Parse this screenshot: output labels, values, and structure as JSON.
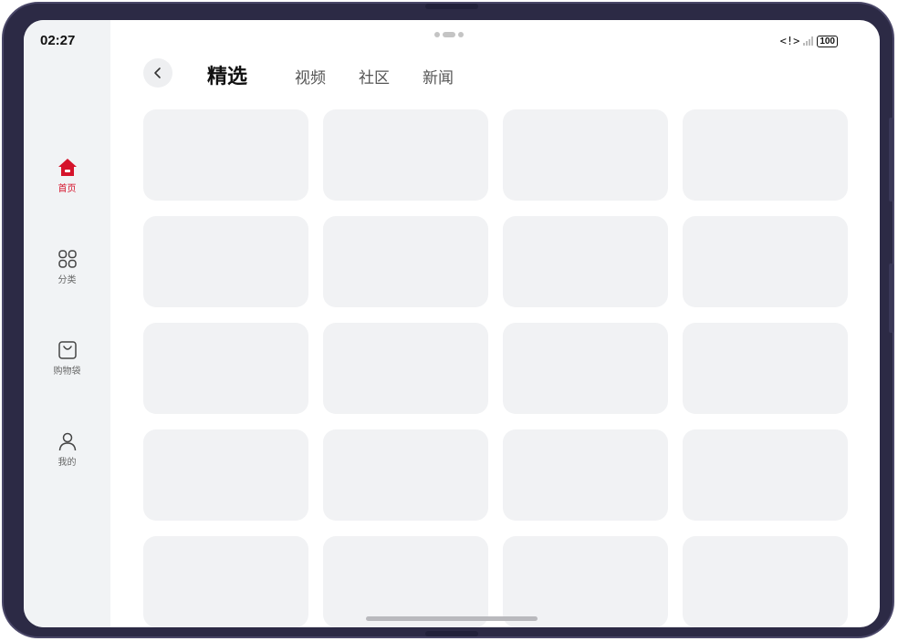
{
  "status_bar": {
    "time": "02:27",
    "network_icon": "<!>",
    "battery": "100"
  },
  "header": {
    "back_icon": "chevron-left-icon",
    "tabs": [
      {
        "label": "精选",
        "active": true
      },
      {
        "label": "视频",
        "active": false
      },
      {
        "label": "社区",
        "active": false
      },
      {
        "label": "新闻",
        "active": false
      }
    ]
  },
  "sidebar": {
    "items": [
      {
        "label": "首页",
        "icon": "home-icon",
        "active": true
      },
      {
        "label": "分类",
        "icon": "grid-icon",
        "active": false
      },
      {
        "label": "购物袋",
        "icon": "shopping-bag-icon",
        "active": false
      },
      {
        "label": "我的",
        "icon": "user-icon",
        "active": false
      }
    ]
  },
  "content": {
    "placeholder_cards": 20
  },
  "colors": {
    "accent": "#d5132b",
    "sidebar_bg": "#f1f3f5",
    "card_bg": "#f1f2f4"
  }
}
